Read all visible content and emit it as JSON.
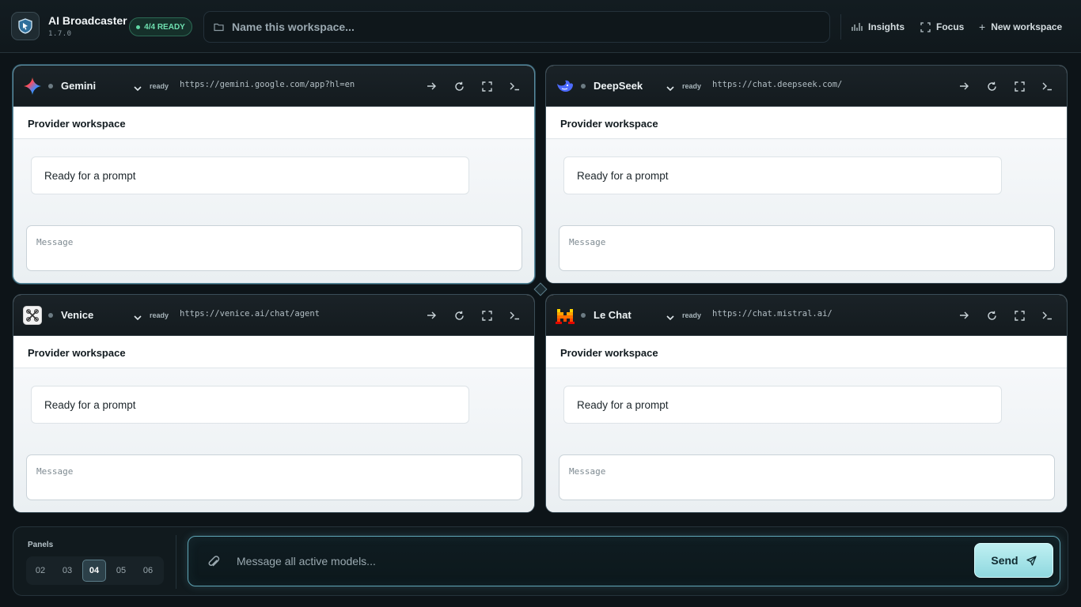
{
  "app": {
    "title": "AI Broadcaster",
    "version": "1.7.0",
    "ready_badge": "4/4 READY"
  },
  "workspace": {
    "name_placeholder": "Name this workspace..."
  },
  "toolbar": {
    "insights": "Insights",
    "focus": "Focus",
    "new_workspace": "New workspace"
  },
  "panels": [
    {
      "provider": "Gemini",
      "icon": "gemini-logo-icon",
      "status": "ready",
      "url": "https://gemini.google.com/app?hl=en",
      "subheader": "Provider workspace",
      "message": "Ready for a prompt",
      "input_placeholder": "Message"
    },
    {
      "provider": "DeepSeek",
      "icon": "deepseek-logo-icon",
      "status": "ready",
      "url": "https://chat.deepseek.com/",
      "subheader": "Provider workspace",
      "message": "Ready for a prompt",
      "input_placeholder": "Message"
    },
    {
      "provider": "Venice",
      "icon": "venice-logo-icon",
      "status": "ready",
      "url": "https://venice.ai/chat/agent",
      "subheader": "Provider workspace",
      "message": "Ready for a prompt",
      "input_placeholder": "Message"
    },
    {
      "provider": "Le Chat",
      "icon": "mistral-logo-icon",
      "status": "ready",
      "url": "https://chat.mistral.ai/",
      "subheader": "Provider workspace",
      "message": "Ready for a prompt",
      "input_placeholder": "Message"
    }
  ],
  "composer": {
    "panels_label": "Panels",
    "panel_counts": [
      "02",
      "03",
      "04",
      "05",
      "06"
    ],
    "selected_count": "04",
    "placeholder": "Message all active models...",
    "send_label": "Send"
  },
  "colors": {
    "background": "#0d1418",
    "accent": "#8fd8df",
    "ready_green": "#5fd8a4"
  }
}
